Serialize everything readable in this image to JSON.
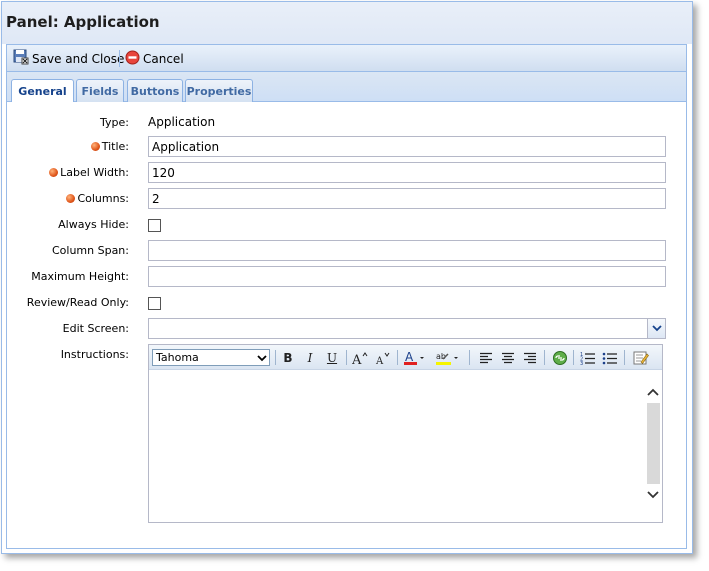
{
  "window": {
    "title": "Panel: Application"
  },
  "toolbar": {
    "save_close_label": "Save and Close",
    "cancel_label": "Cancel"
  },
  "tabs": [
    {
      "label": "General",
      "active": true
    },
    {
      "label": "Fields",
      "active": false
    },
    {
      "label": "Buttons",
      "active": false
    },
    {
      "label": "Properties",
      "active": false
    }
  ],
  "form": {
    "type": {
      "label": "Type:",
      "value": "Application"
    },
    "title": {
      "label": "Title:",
      "value": "Application",
      "required": true
    },
    "label_width": {
      "label": "Label Width:",
      "value": "120",
      "required": true
    },
    "columns": {
      "label": "Columns:",
      "value": "2",
      "required": true
    },
    "always_hide": {
      "label": "Always Hide:",
      "checked": false
    },
    "column_span": {
      "label": "Column Span:",
      "value": ""
    },
    "maximum_height": {
      "label": "Maximum Height:",
      "value": ""
    },
    "review_read_only": {
      "label": "Review/Read Only:",
      "checked": false
    },
    "edit_screen": {
      "label": "Edit Screen:",
      "value": ""
    },
    "instructions": {
      "label": "Instructions:",
      "font": "Tahoma",
      "content": ""
    }
  },
  "colors": {
    "accent_border": "#99bbe8",
    "tab_text": "#15428b",
    "required_dot": "#e0561a",
    "font_color_bar": "#e02020",
    "highlight_bar": "#f5f500"
  },
  "icons": [
    "save-close-icon",
    "cancel-icon",
    "bold-icon",
    "italic-icon",
    "underline-icon",
    "grow-text-icon",
    "shrink-text-icon",
    "font-color-icon",
    "highlight-icon",
    "align-left-icon",
    "align-center-icon",
    "align-right-icon",
    "link-icon",
    "numbered-list-icon",
    "bullet-list-icon",
    "source-edit-icon"
  ]
}
